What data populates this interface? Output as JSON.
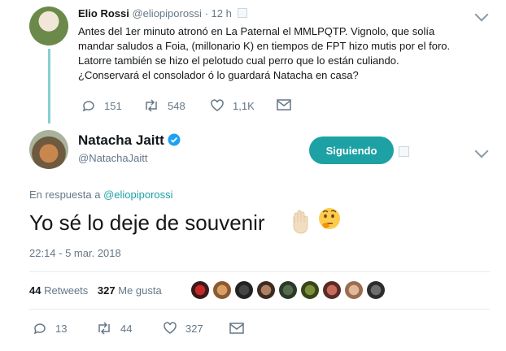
{
  "reply_tweet": {
    "author_name": "Elio Rossi",
    "author_handle": "@eliopiporossi",
    "sep": "·",
    "time": "12 h",
    "lines": [
      "Antes del 1er minuto atronó en La Paternal el MMLPQTP. Vignolo, que solía",
      "mandar saludos a Foia, (millonario K) en tiempos de FPT hizo mutis por el foro.",
      "Latorre también se hizo el pelotudo cual perro que lo están culiando.",
      "¿Conservará el consolador ó lo guardará Natacha en casa?"
    ],
    "replies": "151",
    "retweets": "548",
    "likes": "1,1K"
  },
  "main_tweet": {
    "author_name": "Natacha Jaitt",
    "author_handle": "@NatachaJaitt",
    "follow_label": "Siguiendo",
    "in_reply_prefix": "En respuesta a",
    "in_reply_handle": "@eliopiporossi",
    "text": "Yo sé lo deje de souvenir",
    "timestamp": "22:14 - 5 mar. 2018",
    "stats": {
      "retweets_count": "44",
      "retweets_label": "Retweets",
      "likes_count": "327",
      "likes_label": "Me gusta"
    },
    "actions": {
      "replies": "13",
      "retweets": "44",
      "likes": "327"
    }
  },
  "colors": {
    "accent": "#1da1a4",
    "verified": "#1da1f2",
    "muted": "#657786",
    "thread": "#86d1cf"
  },
  "icons": [
    "reply-icon",
    "retweet-icon",
    "like-icon",
    "message-icon",
    "verified-icon",
    "chevron-down-icon"
  ]
}
